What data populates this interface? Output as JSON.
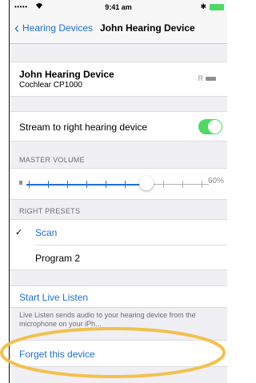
{
  "status": {
    "signal": "•••••",
    "wifi": "wifi-icon",
    "time": "9:41 am",
    "bluetooth": "bluetooth-icon"
  },
  "nav": {
    "back_label": "Hearing Devices",
    "title": "John Hearing Device"
  },
  "device": {
    "name": "John Hearing Device",
    "model": "Cochlear CP1000",
    "side": "R"
  },
  "stream": {
    "label": "Stream to right hearing device",
    "enabled": true
  },
  "volume": {
    "header": "MASTER VOLUME",
    "value": 60,
    "value_text": "60%"
  },
  "presets": {
    "header": "RIGHT PRESETS",
    "items": [
      {
        "label": "Scan",
        "selected": true,
        "check": "✓"
      },
      {
        "label": "Program 2",
        "selected": false
      }
    ]
  },
  "live_listen": {
    "button_label": "Start Live Listen",
    "note": "Live Listen sends audio to your hearing device from the microphone on your iPh..."
  },
  "forget": {
    "label": "Forget this device"
  },
  "colors": {
    "accent": "#1f6fd6",
    "toggle_on": "#4cd964",
    "highlight": "#f2c14e"
  }
}
